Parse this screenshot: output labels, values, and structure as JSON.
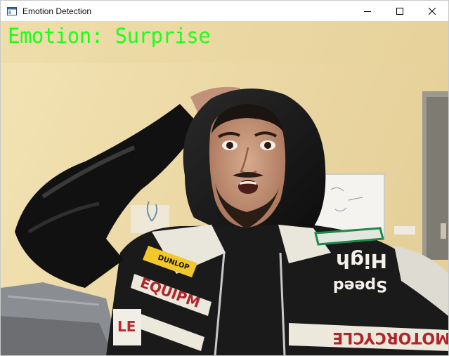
{
  "window": {
    "title": "Emotion Detection",
    "icon": "app-window-icon",
    "controls": [
      "minimize-icon",
      "maximize-icon",
      "close-icon"
    ]
  },
  "overlay": {
    "emotion_label": "Emotion: Surprise",
    "color": "#1aff1a"
  },
  "jacket_text": {
    "patch_left": "EQUIPM",
    "patch_bottom_left": "LE",
    "patch_right_top": "High",
    "patch_right_mid": "Speed",
    "patch_right_bottom": "MOTORCYCLE",
    "badge": "DUNLOP"
  },
  "colors": {
    "wall": "#ead9a8",
    "hoodie": "#151515",
    "skin": "#c99a7d"
  }
}
